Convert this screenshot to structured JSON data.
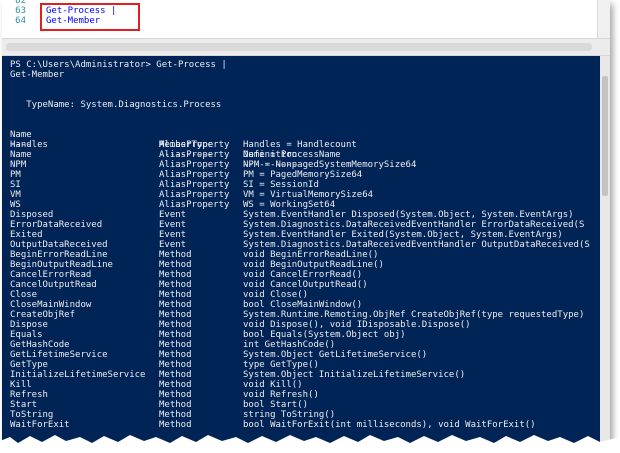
{
  "editor": {
    "lines": [
      {
        "number": "62",
        "code": ""
      },
      {
        "number": "63",
        "code": "Get-Process |"
      },
      {
        "number": "64",
        "code": "Get-Member"
      }
    ]
  },
  "console": {
    "prompt": "PS C:\\Users\\Administrator> Get-Process |",
    "prompt_cont": "Get-Member",
    "typename": "   TypeName: System.Diagnostics.Process",
    "headers": [
      "Name",
      "MemberType",
      "Definition"
    ],
    "separators": [
      "----",
      "----------",
      "----------"
    ],
    "rows": [
      [
        "Handles",
        "AliasProperty",
        "Handles = Handlecount"
      ],
      [
        "Name",
        "AliasProperty",
        "Name = ProcessName"
      ],
      [
        "NPM",
        "AliasProperty",
        "NPM = NonpagedSystemMemorySize64"
      ],
      [
        "PM",
        "AliasProperty",
        "PM = PagedMemorySize64"
      ],
      [
        "SI",
        "AliasProperty",
        "SI = SessionId"
      ],
      [
        "VM",
        "AliasProperty",
        "VM = VirtualMemorySize64"
      ],
      [
        "WS",
        "AliasProperty",
        "WS = WorkingSet64"
      ],
      [
        "Disposed",
        "Event",
        "System.EventHandler Disposed(System.Object, System.EventArgs)"
      ],
      [
        "ErrorDataReceived",
        "Event",
        "System.Diagnostics.DataReceivedEventHandler ErrorDataReceived(S"
      ],
      [
        "Exited",
        "Event",
        "System.EventHandler Exited(System.Object, System.EventArgs)"
      ],
      [
        "OutputDataReceived",
        "Event",
        "System.Diagnostics.DataReceivedEventHandler OutputDataReceived(S"
      ],
      [
        "BeginErrorReadLine",
        "Method",
        "void BeginErrorReadLine()"
      ],
      [
        "BeginOutputReadLine",
        "Method",
        "void BeginOutputReadLine()"
      ],
      [
        "CancelErrorRead",
        "Method",
        "void CancelErrorRead()"
      ],
      [
        "CancelOutputRead",
        "Method",
        "void CancelOutputRead()"
      ],
      [
        "Close",
        "Method",
        "void Close()"
      ],
      [
        "CloseMainWindow",
        "Method",
        "bool CloseMainWindow()"
      ],
      [
        "CreateObjRef",
        "Method",
        "System.Runtime.Remoting.ObjRef CreateObjRef(type requestedType)"
      ],
      [
        "Dispose",
        "Method",
        "void Dispose(), void IDisposable.Dispose()"
      ],
      [
        "Equals",
        "Method",
        "bool Equals(System.Object obj)"
      ],
      [
        "GetHashCode",
        "Method",
        "int GetHashCode()"
      ],
      [
        "GetLifetimeService",
        "Method",
        "System.Object GetLifetimeService()"
      ],
      [
        "GetType",
        "Method",
        "type GetType()"
      ],
      [
        "InitializeLifetimeService",
        "Method",
        "System.Object InitializeLifetimeService()"
      ],
      [
        "Kill",
        "Method",
        "void Kill()"
      ],
      [
        "Refresh",
        "Method",
        "void Refresh()"
      ],
      [
        "Start",
        "Method",
        "bool Start()"
      ],
      [
        "ToString",
        "Method",
        "string ToString()"
      ],
      [
        "WaitForExit",
        "Method",
        "bool WaitForExit(int milliseconds), void WaitForExit()"
      ]
    ]
  },
  "colors": {
    "console_bg": "#012456",
    "console_fg": "#eeedf0",
    "editor_keyword": "#0000ff",
    "line_number": "#2b91af",
    "highlight_border": "#e02020"
  }
}
